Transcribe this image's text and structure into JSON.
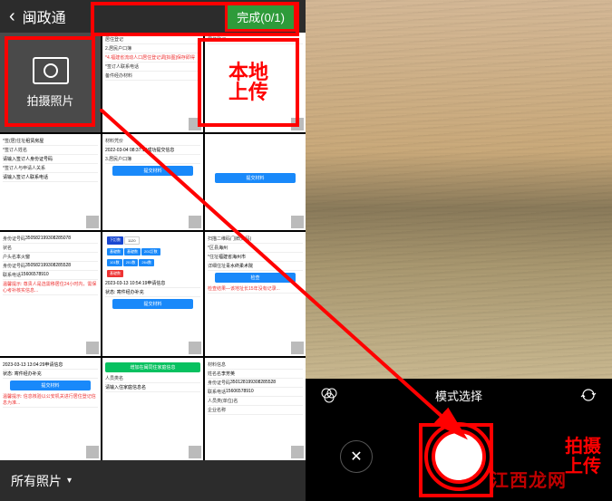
{
  "left": {
    "header_title": "闽政通",
    "done_label": "完成(0/1)",
    "camera_label": "拍摄照片",
    "upload_label_1": "本地",
    "upload_label_2": "上传",
    "footer_label": "所有照片",
    "thumbs": {
      "t2": {
        "l1": "居住登记",
        "l2": "2.居民户口簿",
        "l3": "*4.福建省流动人口居住登记调[拟图]保存即得",
        "l4": "*签订人联系电话",
        "l5": "备件经办材料"
      },
      "t3": {
        "l1": "居住登记"
      },
      "t4": {
        "l1": "*签(居)住址",
        "l2": "租赁房屋",
        "l3": "*签订人姓名",
        "l4": "请输入签订人身份证号码",
        "l5": "*签订人与申请人关系",
        "l6": "请输入签订人联系电话"
      },
      "t5": {
        "l1": "材料凭价",
        "l2": "2022-03-04 08:37:19成功提交信息",
        "l3": "3.居民户口簿",
        "btn": "提交材料"
      },
      "t6": {
        "btn": "提交材料"
      },
      "t7": {
        "l1": "身份证号码",
        "v1": "350582199308285078",
        "l2": "状名",
        "l3": "户头名",
        "v3": "本火窗",
        "l4": "身份证号码",
        "v4": "350582199308285528",
        "l5": "联系电话",
        "v5": "15606578910",
        "red": "温馨提示: 尊贵人是选需移居住24小时内，需保心考补核实信息..."
      },
      "t8": {
        "tag1": "下訂数",
        "tag2": "1120",
        "tags": [
          "基礎数",
          "基礎数",
          "201訂数"
        ],
        "row2": [
          "101数",
          "201数",
          "264数"
        ],
        "btn": "基礎数",
        "l1": "2023-03-13 10:54:19申请信息",
        "l2": "状态: 寄件经办补充",
        "btn2": "提交材料"
      },
      "t9": {
        "l1": "扫描二维码门牌(寄码)",
        "l2": "*区县",
        "v2": "海州",
        "l3": "*住址",
        "v3": "福建省海州市",
        "l4": "详细住址",
        "v4": "青水终柔术院",
        "btn": "检查",
        "red": "检查结果",
        "red2": "—该地址长15年没有记录..."
      },
      "t10": {
        "l1": "2023-03-13 13:04:29申请信息",
        "l2": "状态: 寄件经办补充",
        "btn": "提交材料",
        "red": "温馨提示: 信息核验以公安机关进行居住登记信息为准..."
      },
      "t11": {
        "btn_green": "增加在闽同住家庭信息",
        "l1": "人员类名",
        "l2": "请输入住家庭信息名"
      },
      "t12": {
        "l1": "材料信息",
        "l2": "姓名名",
        "v2": "李芳英",
        "l3": "身份证号码",
        "v3": "350128199308285528",
        "l4": "联系电话",
        "v4": "15606578910",
        "l5": "人员类(单位)名",
        "l6": "企业名称"
      }
    }
  },
  "right": {
    "mode_label": "模式选择",
    "shoot_label_1": "拍摄",
    "shoot_label_2": "上传"
  },
  "watermark": "江西龙网"
}
